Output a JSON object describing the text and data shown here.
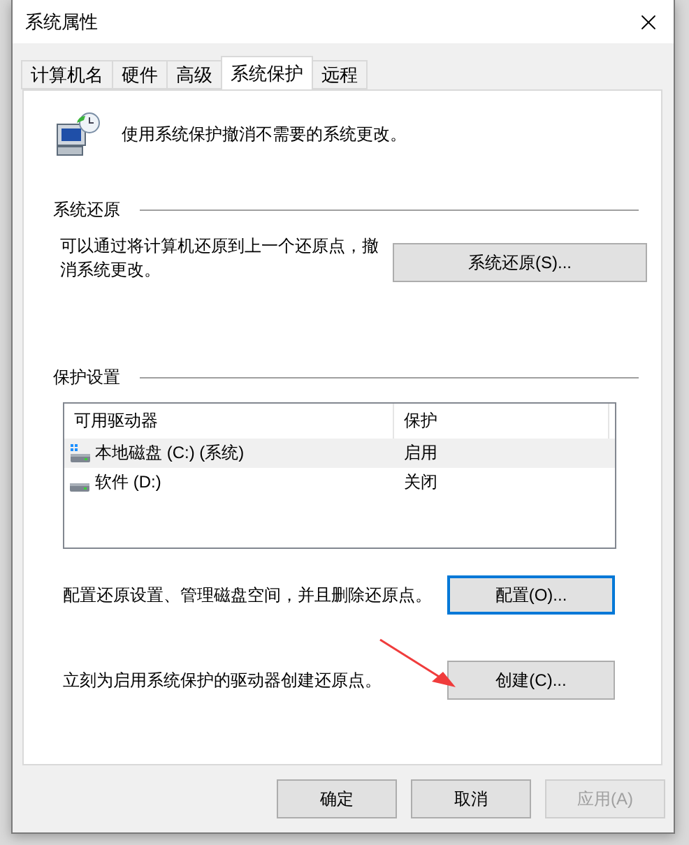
{
  "window": {
    "title": "系统属性"
  },
  "tabs": [
    {
      "label": "计算机名",
      "selected": false
    },
    {
      "label": "硬件",
      "selected": false
    },
    {
      "label": "高级",
      "selected": false
    },
    {
      "label": "系统保护",
      "selected": true
    },
    {
      "label": "远程",
      "selected": false
    }
  ],
  "intro": "使用系统保护撤消不需要的系统更改。",
  "restore": {
    "heading": "系统还原",
    "text": "可以通过将计算机还原到上一个还原点，撤消系统更改。",
    "button": {
      "label": "系统还原(S)...",
      "focused": false
    }
  },
  "protection": {
    "heading": "保护设置",
    "columns": [
      "可用驱动器",
      "保护"
    ],
    "drives": [
      {
        "name": "本地磁盘 (C:) (系统)",
        "status": "启用",
        "kind": "system",
        "selected": true
      },
      {
        "name": "软件 (D:)",
        "status": "关闭",
        "kind": "data",
        "selected": false
      }
    ],
    "actions": [
      {
        "text": "配置还原设置、管理磁盘空间，并且删除还原点。",
        "button": {
          "label": "配置(O)...",
          "focused": true
        }
      },
      {
        "text": "立刻为启用系统保护的驱动器创建还原点。",
        "button": {
          "label": "创建(C)...",
          "focused": false
        }
      }
    ]
  },
  "footer": [
    {
      "label": "确定",
      "disabled": false
    },
    {
      "label": "取消",
      "disabled": false
    },
    {
      "label": "应用(A)",
      "disabled": true
    }
  ]
}
